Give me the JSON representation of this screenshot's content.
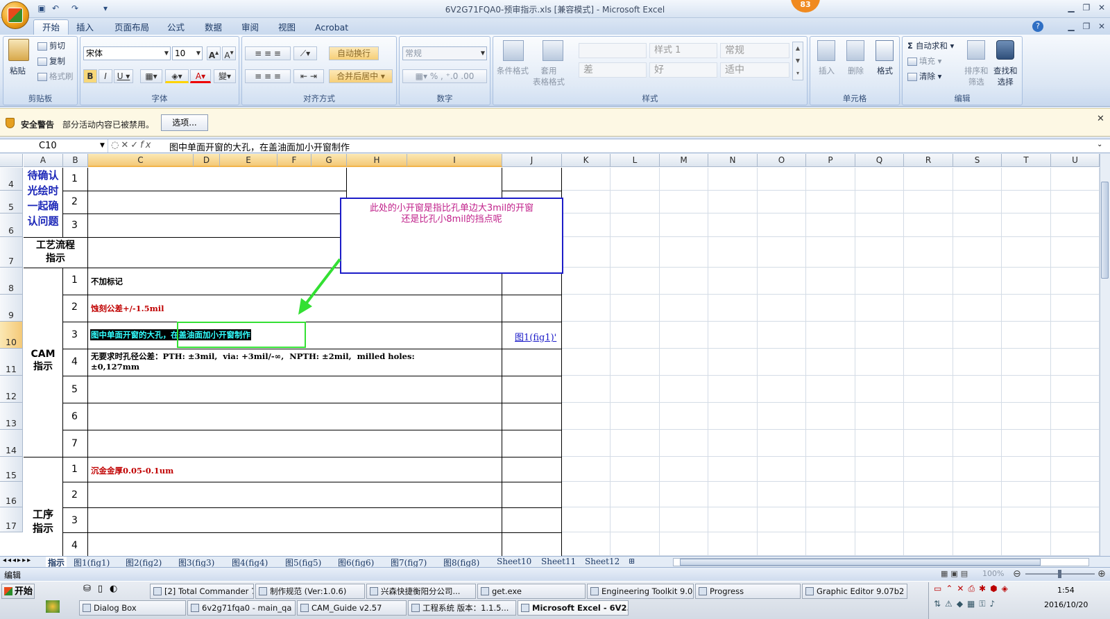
{
  "window": {
    "title": "6V2G71FQA0-预审指示.xls  [兼容模式] - Microsoft Excel",
    "badge": "83"
  },
  "tabs": [
    "开始",
    "插入",
    "页面布局",
    "公式",
    "数据",
    "审阅",
    "视图",
    "Acrobat"
  ],
  "ribbon": {
    "clipboard": {
      "paste": "粘贴",
      "cut": "剪切",
      "copy": "复制",
      "format_painter": "格式刷",
      "label": "剪贴板"
    },
    "font": {
      "name": "宋体",
      "size": "10",
      "label": "字体"
    },
    "alignment": {
      "wrap": "自动换行",
      "merge": "合并后居中",
      "label": "对齐方式"
    },
    "number": {
      "format": "常规",
      "label": "数字"
    },
    "styles": {
      "cond": "条件格式",
      "table": "套用\n表格格式",
      "s1": "样式 1",
      "normal": "常规",
      "bad": "差",
      "good": "好",
      "neutral": "适中",
      "label": "样式"
    },
    "cells": {
      "insert": "插入",
      "delete": "删除",
      "format": "格式",
      "label": "单元格"
    },
    "editing": {
      "autosum": "自动求和",
      "fill": "填充",
      "clear": "清除",
      "sort": "排序和\n筛选",
      "find": "查找和\n选择",
      "label": "编辑"
    }
  },
  "security": {
    "title": "安全警告",
    "message": "部分活动内容已被禁用。",
    "options": "选项..."
  },
  "formula_bar": {
    "name_box": "C10",
    "formula": "图中单面开窗的大孔，在盖油面加小开窗制作"
  },
  "columns": [
    "A",
    "B",
    "C",
    "D",
    "E",
    "F",
    "G",
    "H",
    "I",
    "J",
    "K",
    "L",
    "M",
    "N",
    "O",
    "P",
    "Q",
    "R",
    "S",
    "T",
    "U"
  ],
  "rows": [
    "4",
    "5",
    "6",
    "7",
    "8",
    "9",
    "10",
    "11",
    "12",
    "13",
    "14",
    "15",
    "16",
    "17"
  ],
  "sheet": {
    "pending_label": "待确认\n光绘时\n一起确\n认问题",
    "process_label": "工艺流程\n指示",
    "cam_label": "CAM\n指示",
    "step_label": "工序\n指示",
    "pending_nums": [
      "1",
      "2",
      "3"
    ],
    "cam_nums": [
      "1",
      "2",
      "3",
      "4",
      "5",
      "6",
      "7"
    ],
    "step_nums": [
      "1",
      "2",
      "3",
      "4"
    ],
    "cam_items": [
      "不加标记",
      "蚀刻公差+/-1.5mil",
      "图中单面开窗的大孔，在盖油面加小开窗制作",
      "无要求时孔径公差：PTH: ±3mil,  via: +3mil/-∞,  NPTH: ±2mil,  milled holes:\n±0,127mm"
    ],
    "step_items": [
      "沉金金厚0.05-0.1um"
    ],
    "link": "图1(fig1)'",
    "callout": "此处的小开窗是指比孔单边大3mil的开窗\n还是比孔小8mil的挡点呢"
  },
  "sheet_tabs": [
    "指示",
    "图1(fig1)",
    "图2(fig2)",
    "图3(fig3)",
    "图4(fig4)",
    "图5(fig5)",
    "图6(fig6)",
    "图7(fig7)",
    "图8(fig8)",
    "Sheet10",
    "Sheet11",
    "Sheet12"
  ],
  "status": {
    "mode": "编辑",
    "zoom": "100%"
  },
  "taskbar": {
    "start": "开始",
    "row1": [
      "[2] Total Commander 7....",
      "制作规范 (Ver:1.0.6)",
      "兴森快捷衡阳分公司...",
      "get.exe",
      "Engineering Toolkit 9.07...",
      "Progress",
      "Graphic Editor 9.07b2 (0..."
    ],
    "row2": [
      "Dialog Box",
      "6v2g71fqa0 - main_qa",
      "CAM_Guide v2.57",
      "工程系统  版本：1.1.5...",
      "Microsoft Excel - 6V2..."
    ],
    "time": "1:54",
    "date": "2016/10/20"
  },
  "colors": {
    "accent": "#f2b44b",
    "callout_border": "#1c1cc8",
    "callout_text": "#c0208a",
    "arrow": "#33e033",
    "red_text": "#c00000"
  }
}
